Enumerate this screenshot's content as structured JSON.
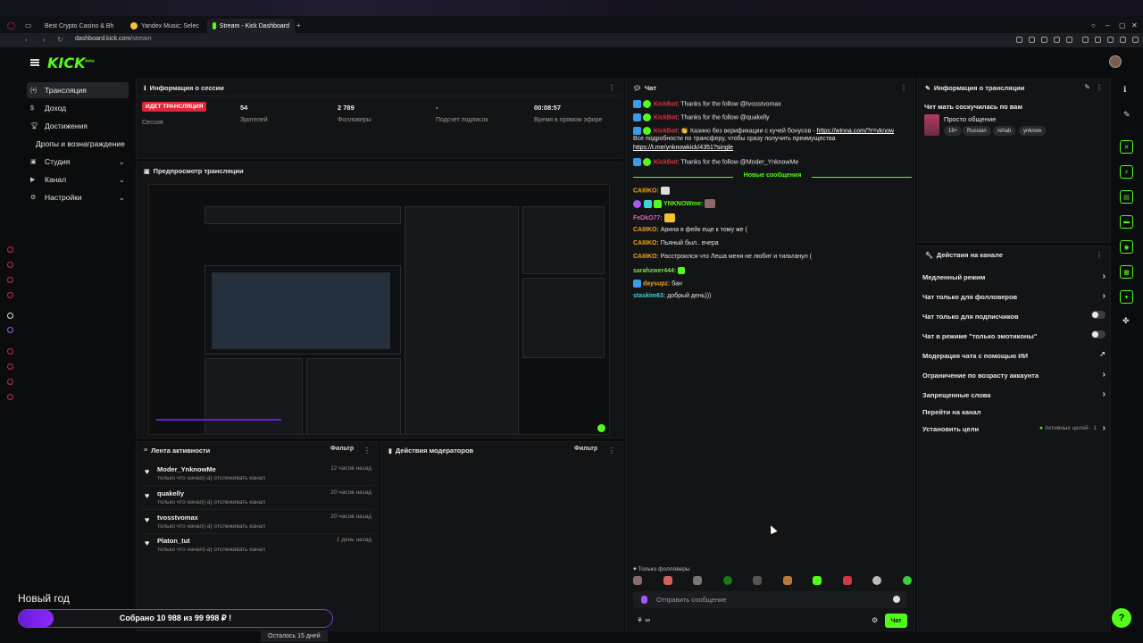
{
  "browser": {
    "tabs": [
      {
        "label": "Best Crypto Casino & Bh"
      },
      {
        "label": "Yandex Music: Selec"
      },
      {
        "label": "Stream - Kick Dashboard"
      }
    ],
    "url_host": "dashboard.kick.com",
    "url_path": "/stream"
  },
  "brand": {
    "logo": "KICK",
    "logo_sup": "beta",
    "accent": "#53fc18"
  },
  "nav": {
    "items": [
      {
        "label": "Трансляция"
      },
      {
        "label": "Доход"
      },
      {
        "label": "Достижения"
      },
      {
        "label": "Дропы и вознаграждение"
      },
      {
        "label": "Студия"
      },
      {
        "label": "Канал"
      },
      {
        "label": "Настройки"
      }
    ]
  },
  "goal": {
    "title": "Новый год",
    "text": "Собрано 10 988  из 99 998 ₽ !",
    "remaining": "Осталось 15 дней",
    "progress": 0.11
  },
  "session": {
    "title": "Информация о сессии",
    "live_badge": "ИДЕТ ТРАНСЛЯЦИЯ",
    "live_label": "Сессия",
    "stats": [
      {
        "value": "54",
        "label": "Зрителей"
      },
      {
        "value": "2 789",
        "label": "Фолловеры"
      },
      {
        "value": "-",
        "label": "Подсчет подписок"
      },
      {
        "value": "00:08:57",
        "label": "Время в прямом эфире"
      }
    ]
  },
  "preview": {
    "title": "Предпросмотр трансляции"
  },
  "activity": {
    "title": "Лента активности",
    "filter": "Фильтр",
    "items": [
      {
        "name": "Moder_YnknowMe",
        "sub": "только что начал(-а) отслеживать канал",
        "time": "12 часов назад"
      },
      {
        "name": "quakelly",
        "sub": "только что начал(-а) отслеживать канал",
        "time": "20 часов назад"
      },
      {
        "name": "tvosstvomax",
        "sub": "только что начал(-а) отслеживать канал",
        "time": "20 часов назад"
      },
      {
        "name": "Platon_tut",
        "sub": "только что начал(-а) отслеживать канал",
        "time": "1 день назад"
      }
    ]
  },
  "moderators": {
    "title": "Действия модераторов",
    "filter": "Фильтр"
  },
  "chat": {
    "title": "Чат",
    "bot": "KickBot",
    "lines": [
      {
        "text": ": Thanks for the follow @tvosstvomax"
      },
      {
        "text": ": Thanks for the follow @quakelly"
      },
      {
        "text": ": 👏 Казино без верификации с кучей бонусов - ",
        "link": "https://winna.com/?r=yknow",
        "text2": "Все подробности по трансферу, чтобы сразу получить преимущества",
        "link2": "https://t.me/ynknowkick/4351?single"
      },
      {
        "text": ": Thanks for the follow @Moder_YnknowMe"
      }
    ],
    "new_messages": "Новые сообщения",
    "messages": [
      {
        "user": "CAIIIKO:",
        "text": ""
      },
      {
        "user": "YNKNOWme:",
        "text": ""
      },
      {
        "user": "FeDkO77:",
        "text": ""
      },
      {
        "user": "CAIIIKO:",
        "text": "Арина я фейк еще к тому же ("
      },
      {
        "user": "CAIIIKO:",
        "text": "Пьяный был.. вчера"
      },
      {
        "user": "CAIIIKO:",
        "text": "Расстроился что Леша меня не любит и тильтанул ("
      },
      {
        "user": "sarahzwer444:",
        "text": ""
      },
      {
        "user": "daysupz:",
        "text": "бан"
      },
      {
        "user": "staskim63:",
        "text": "добрый день)))"
      }
    ],
    "followers_only": "Только фолловеры",
    "input_placeholder": "Отправить сообщение",
    "send": "Чат",
    "infinity": "∞"
  },
  "broadcast": {
    "title": "Информация о трансляции",
    "stream_title": "Чет мать соскучилась по вам",
    "category": "Просто общение",
    "tags": [
      "18+",
      "Russian",
      "rehab",
      "ynknow"
    ]
  },
  "actions": {
    "title": "Действия на канале",
    "rows": [
      {
        "label": "Медленный режим",
        "kind": "arrow"
      },
      {
        "label": "Чат только для фолловеров",
        "kind": "arrow"
      },
      {
        "label": "Чат только для подписчиков",
        "kind": "toggle"
      },
      {
        "label": "Чат в режиме \"только эмотиконы\"",
        "kind": "toggle"
      },
      {
        "label": "Модерация чата с помощью ИИ",
        "kind": "external"
      },
      {
        "label": "Ограничение по возрасту аккаунта",
        "kind": "arrow"
      },
      {
        "label": "Запрещенные слова",
        "kind": "arrow"
      },
      {
        "label": "Перейти на канал",
        "kind": "none"
      },
      {
        "label": "Установить цели",
        "kind": "arrow",
        "extra": "Активных целей - 1"
      }
    ]
  },
  "colors": {
    "live_red": "#e0263a",
    "bot_red": "#e5303f",
    "goal_purple": "#7d3bd6"
  }
}
